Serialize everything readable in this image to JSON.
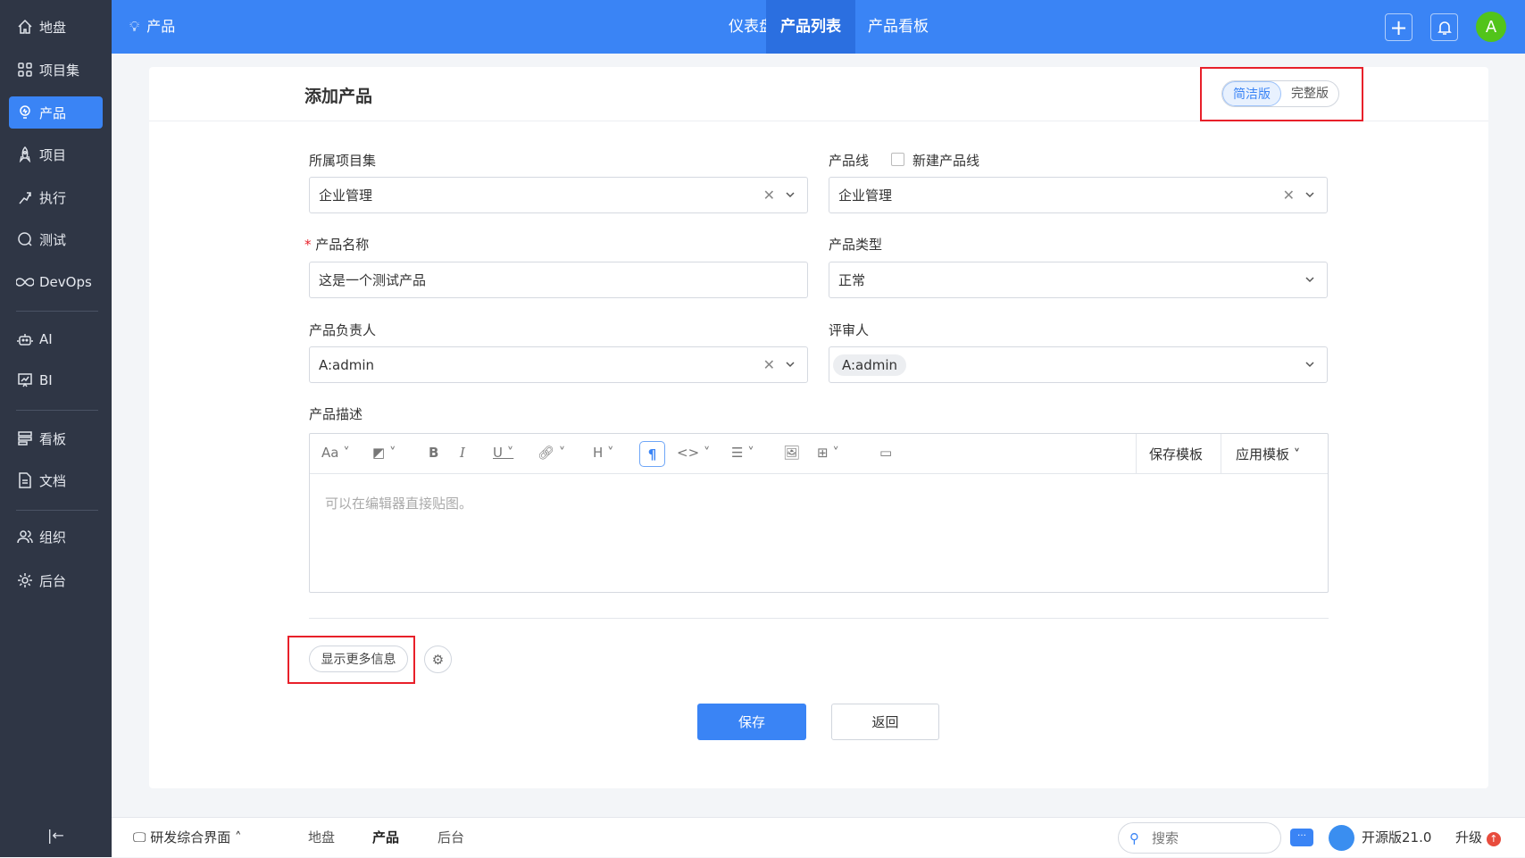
{
  "sidebar": {
    "items": [
      {
        "label": "地盘",
        "icon": "home-icon"
      },
      {
        "label": "项目集",
        "icon": "grid-icon"
      },
      {
        "label": "产品",
        "icon": "bulb-icon",
        "active": true
      },
      {
        "label": "项目",
        "icon": "rocket-icon"
      },
      {
        "label": "执行",
        "icon": "run-icon"
      },
      {
        "label": "测试",
        "icon": "test-icon"
      },
      {
        "label": "DevOps",
        "icon": "infinity-icon"
      },
      {
        "label": "AI",
        "icon": "robot-icon"
      },
      {
        "label": "BI",
        "icon": "chart-icon"
      },
      {
        "label": "看板",
        "icon": "kanban-icon"
      },
      {
        "label": "文档",
        "icon": "doc-icon"
      },
      {
        "label": "组织",
        "icon": "users-icon"
      },
      {
        "label": "后台",
        "icon": "gear-icon"
      }
    ]
  },
  "topbar": {
    "module": "产品",
    "nav": [
      "仪表盘",
      "产品列表",
      "产品看板"
    ],
    "active_nav": "产品列表",
    "avatar": "A"
  },
  "form": {
    "title": "添加产品",
    "mode_simple": "简洁版",
    "mode_full": "完整版",
    "program_label": "所属项目集",
    "program_value": "企业管理",
    "line_label": "产品线",
    "new_line_label": "新建产品线",
    "line_value": "企业管理",
    "name_label": "产品名称",
    "name_value": "这是一个测试产品",
    "type_label": "产品类型",
    "type_value": "正常",
    "owner_label": "产品负责人",
    "owner_value": "A:admin",
    "reviewer_label": "评审人",
    "reviewer_value": "A:admin",
    "desc_label": "产品描述",
    "desc_placeholder": "可以在编辑器直接贴图。",
    "save_template": "保存模板",
    "apply_template": "应用模板",
    "more_info": "显示更多信息",
    "save": "保存",
    "back": "返回"
  },
  "bottombar": {
    "workspace": "研发综合界面",
    "crumbs": [
      "地盘",
      "产品",
      "后台"
    ],
    "search_placeholder": "搜索",
    "version": "开源版21.0",
    "upgrade": "升级"
  }
}
